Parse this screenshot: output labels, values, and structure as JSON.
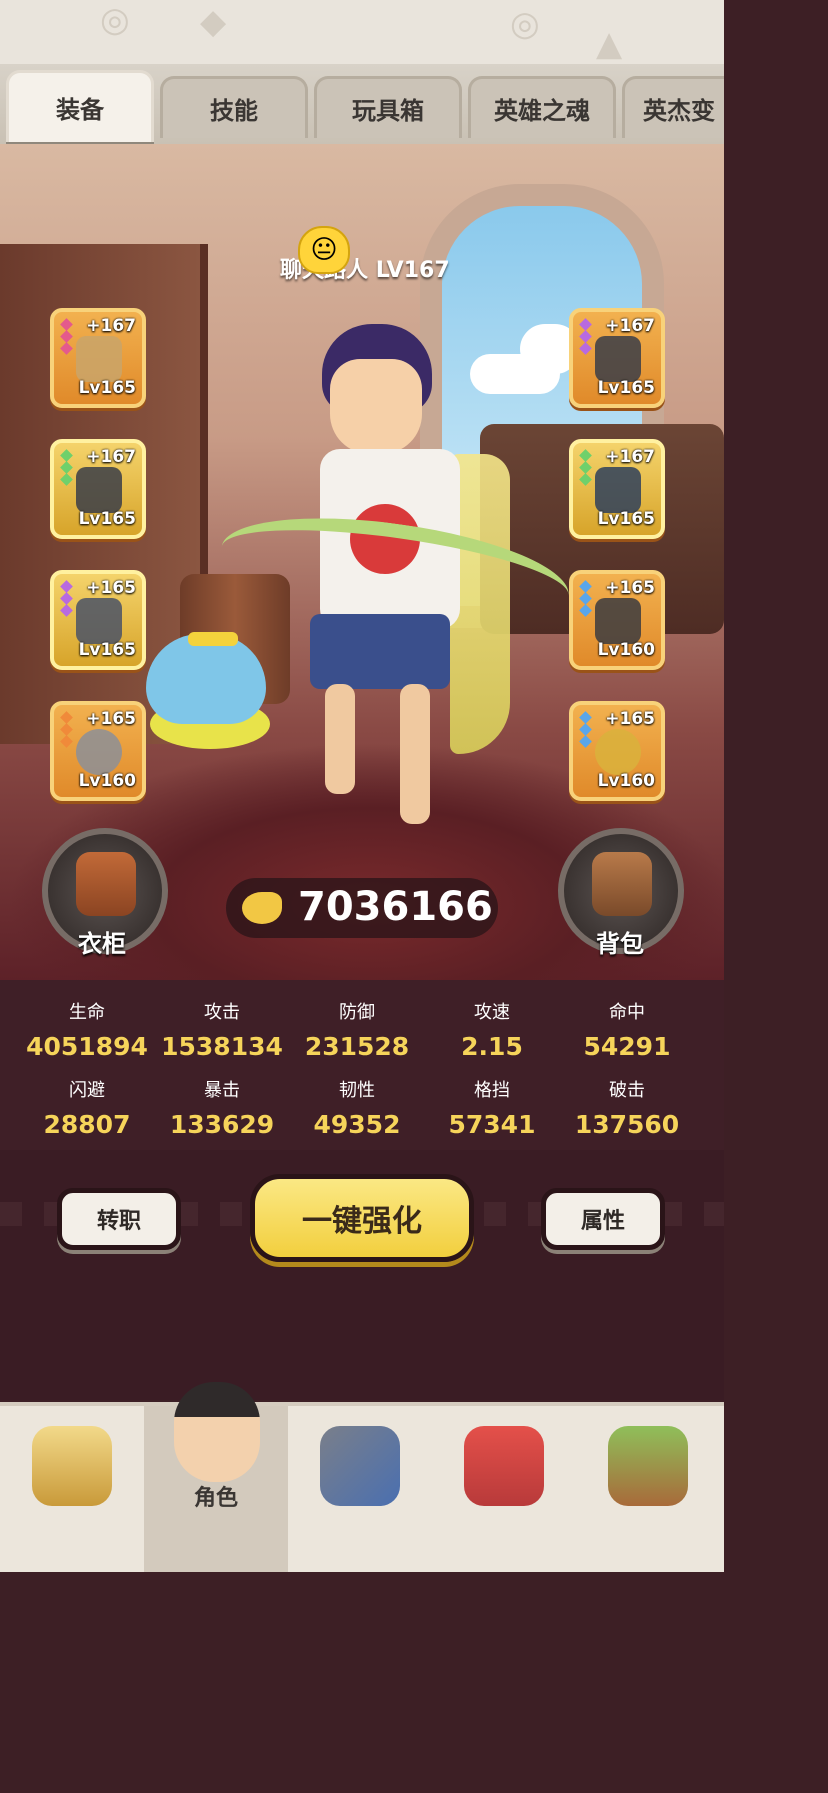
{
  "tabs": [
    {
      "label": "装备",
      "active": true
    },
    {
      "label": "技能",
      "active": false
    },
    {
      "label": "玩具箱",
      "active": false
    },
    {
      "label": "英雄之魂",
      "active": false
    },
    {
      "label": "英杰变",
      "active": false
    }
  ],
  "player": {
    "name": "聊天路人",
    "level": "LV167",
    "emoji": "😐"
  },
  "equipment_left": [
    {
      "name": "bow-icon",
      "plus": "+167",
      "level": "Lv165",
      "rarity": "orange",
      "gem_color": "#e45a8c"
    },
    {
      "name": "helmet-icon",
      "plus": "+167",
      "level": "Lv165",
      "rarity": "gold",
      "gem_color": "#6fd06b"
    },
    {
      "name": "gauntlet-icon",
      "plus": "+165",
      "level": "Lv165",
      "rarity": "gold",
      "gem_color": "#b86ae0"
    },
    {
      "name": "ring-icon",
      "plus": "+165",
      "level": "Lv160",
      "rarity": "orange",
      "gem_color": "#f08a3a"
    }
  ],
  "equipment_right": [
    {
      "name": "claw-icon",
      "plus": "+167",
      "level": "Lv165",
      "rarity": "orange",
      "gem_color": "#b86ae0"
    },
    {
      "name": "armor-icon",
      "plus": "+167",
      "level": "Lv165",
      "rarity": "gold",
      "gem_color": "#6fd06b"
    },
    {
      "name": "boots-icon",
      "plus": "+165",
      "level": "Lv160",
      "rarity": "orange",
      "gem_color": "#5aa6ea"
    },
    {
      "name": "necklace-icon",
      "plus": "+165",
      "level": "Lv160",
      "rarity": "orange",
      "gem_color": "#5aa6ea"
    }
  ],
  "wardrobe": {
    "label": "衣柜",
    "icon": "vest-icon"
  },
  "backpack": {
    "label": "背包",
    "icon": "backpack-icon"
  },
  "gold": {
    "value": "7036166",
    "icon": "coin-icon"
  },
  "stats": [
    {
      "label": "生命",
      "value": "4051894"
    },
    {
      "label": "攻击",
      "value": "1538134"
    },
    {
      "label": "防御",
      "value": "231528"
    },
    {
      "label": "攻速",
      "value": "2.15"
    },
    {
      "label": "命中",
      "value": "54291"
    },
    {
      "label": "闪避",
      "value": "28807"
    },
    {
      "label": "暴击",
      "value": "133629"
    },
    {
      "label": "韧性",
      "value": "49352"
    },
    {
      "label": "格挡",
      "value": "57341"
    },
    {
      "label": "破击",
      "value": "137560"
    }
  ],
  "actions": {
    "transfer": "转职",
    "enhance_all": "一键强化",
    "attributes": "属性"
  },
  "bottom_nav": [
    {
      "label": "",
      "icon": "lion-mask-icon",
      "active": false
    },
    {
      "label": "角色",
      "icon": "character-avatar-icon",
      "active": true
    },
    {
      "label": "",
      "icon": "sword-shield-icon",
      "active": false
    },
    {
      "label": "",
      "icon": "pet-dino-icon",
      "active": false
    },
    {
      "label": "",
      "icon": "totem-icon",
      "active": false
    }
  ],
  "colors": {
    "accent_gold": "#f6d45a",
    "slot_orange": "#e08a2a",
    "slot_gold": "#d7a42a",
    "background": "#3d1f25"
  }
}
